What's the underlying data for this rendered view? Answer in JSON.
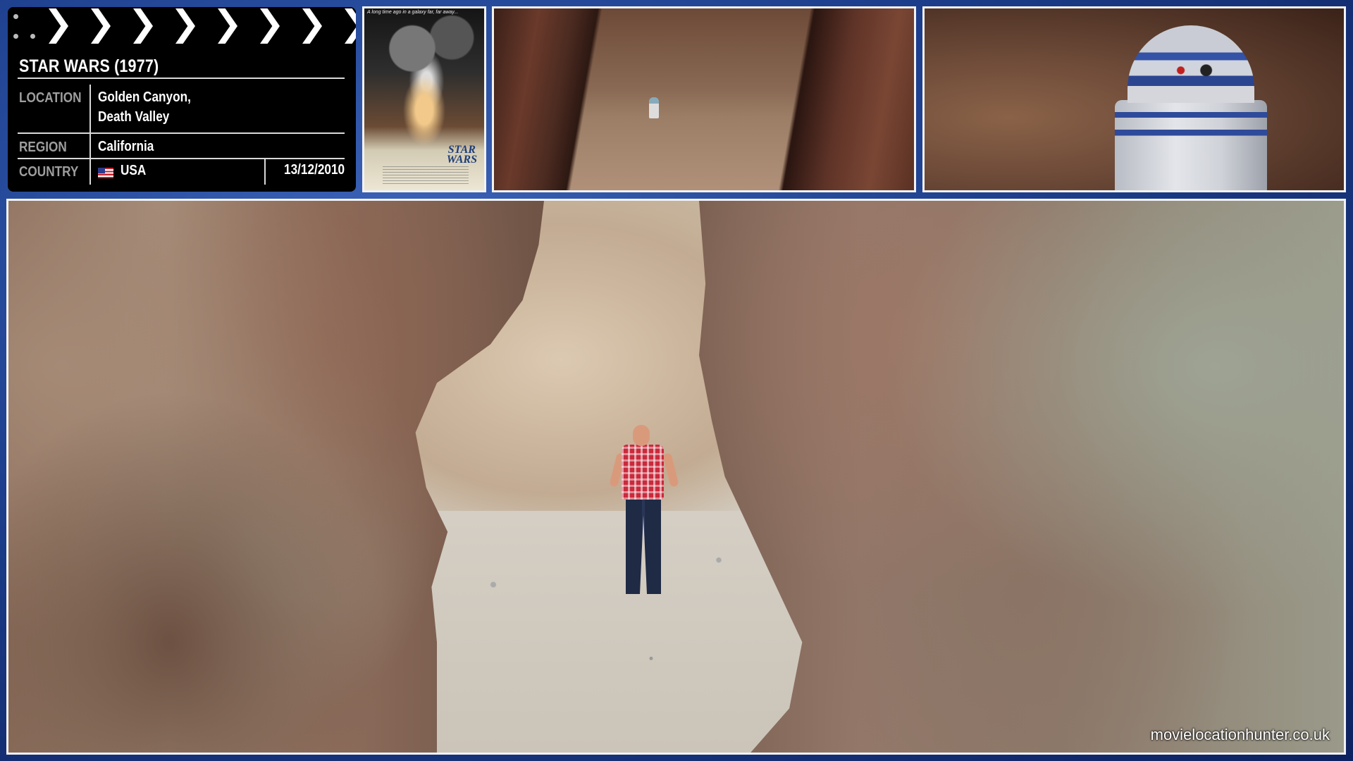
{
  "clapperboard": {
    "title": "STAR WARS (1977)",
    "location_label": "LOCATION",
    "location_line1": "Golden Canyon,",
    "location_line2": "Death Valley",
    "region_label": "REGION",
    "region_value": "California",
    "country_label": "COUNTRY",
    "country_value": "USA",
    "date": "13/12/2010",
    "flag_icon": "us-flag-icon"
  },
  "poster": {
    "tagline": "A long time ago in a galaxy far, far away...",
    "logo_line1": "STAR",
    "logo_line2": "WARS"
  },
  "stills": {
    "still_1": "film-still-canyon",
    "still_2": "film-still-r2d2"
  },
  "main_photo": {
    "watermark": "movielocationhunter.co.uk"
  }
}
